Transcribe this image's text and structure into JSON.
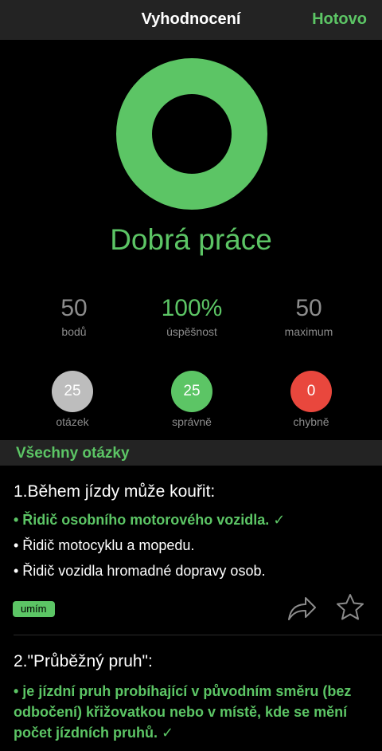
{
  "navbar": {
    "title": "Vyhodnocení",
    "done_label": "Hotovo"
  },
  "result": {
    "headline": "Dobrá práce",
    "ring_fraction": 1.0,
    "ring_color": "#5cc565"
  },
  "stats": [
    {
      "value": "50",
      "label": "bodů"
    },
    {
      "value": "100%",
      "label": "úspěšnost"
    },
    {
      "value": "50",
      "label": "maximum"
    }
  ],
  "counts": [
    {
      "value": "25",
      "label": "otázek",
      "color": "#bdbdbd"
    },
    {
      "value": "25",
      "label": "správně",
      "color": "#5cc565"
    },
    {
      "value": "0",
      "label": "chybně",
      "color": "#e9473d"
    }
  ],
  "section": {
    "title": "Všechny otázky"
  },
  "questions": [
    {
      "title": "1.Během jízdy může kouřit:",
      "answers": [
        "• Řidič osobního motorového vozidla. ✓",
        "• Řidič motocyklu a mopedu.",
        "• Řidič vozidla hromadné dopravy osob."
      ],
      "badge": "umím",
      "share_icon": "share-icon",
      "star_icon": "star-icon"
    },
    {
      "title": "2.\"Průběžný pruh\":",
      "answers": [
        "• je jízdní pruh probíhající v původním směru (bez odbočení) křižovatkou nebo v místě, kde se mění počet jízdních pruhů. ✓"
      ]
    }
  ],
  "colors": {
    "accent": "#5cc565",
    "wrong": "#e9473d",
    "neutral": "#bdbdbd",
    "bar": "#232323"
  }
}
